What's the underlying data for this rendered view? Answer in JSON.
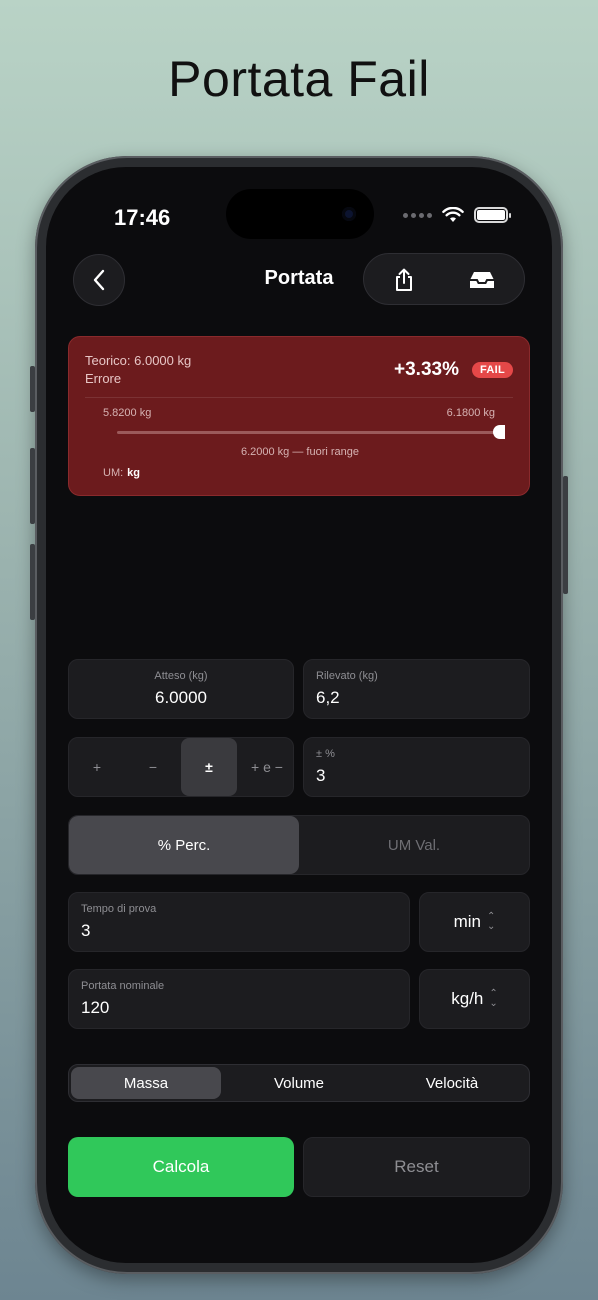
{
  "promo": {
    "title": "Portata Fail"
  },
  "status": {
    "time": "17:46"
  },
  "nav": {
    "title": "Portata"
  },
  "result": {
    "teorico": "Teorico: 6.0000 kg",
    "errore": "Errore",
    "percent": "+3.33%",
    "badge": "FAIL",
    "min": "5.8200 kg",
    "max": "6.1800 kg",
    "value_text": "6.2000 kg — fuori range",
    "um_label": "UM:",
    "um_value": "kg",
    "colors": {
      "card": "#6c1b1d",
      "badge": "#e54848"
    }
  },
  "fields": {
    "atteso": {
      "label": "Atteso (kg)",
      "value": "6.0000"
    },
    "rilevato": {
      "label": "Rilevato (kg)",
      "value": "6,2"
    },
    "tolerance": {
      "label": "± %",
      "value": "3"
    },
    "tempo": {
      "label": "Tempo di prova",
      "value": "3"
    },
    "portata": {
      "label": "Portata nominale",
      "value": "120"
    }
  },
  "tolerance_mode": {
    "options": [
      "+",
      "−",
      "±",
      "+ e −"
    ],
    "selected": "±"
  },
  "tolerance_type": {
    "options": [
      "% Perc.",
      "UM Val."
    ],
    "selected": "% Perc."
  },
  "units": {
    "time": "min",
    "flow": "kg/h"
  },
  "category": {
    "options": [
      "Massa",
      "Volume",
      "Velocità"
    ],
    "selected": "Massa"
  },
  "actions": {
    "calcola": "Calcola",
    "reset": "Reset",
    "calcola_color": "#30c85a"
  }
}
